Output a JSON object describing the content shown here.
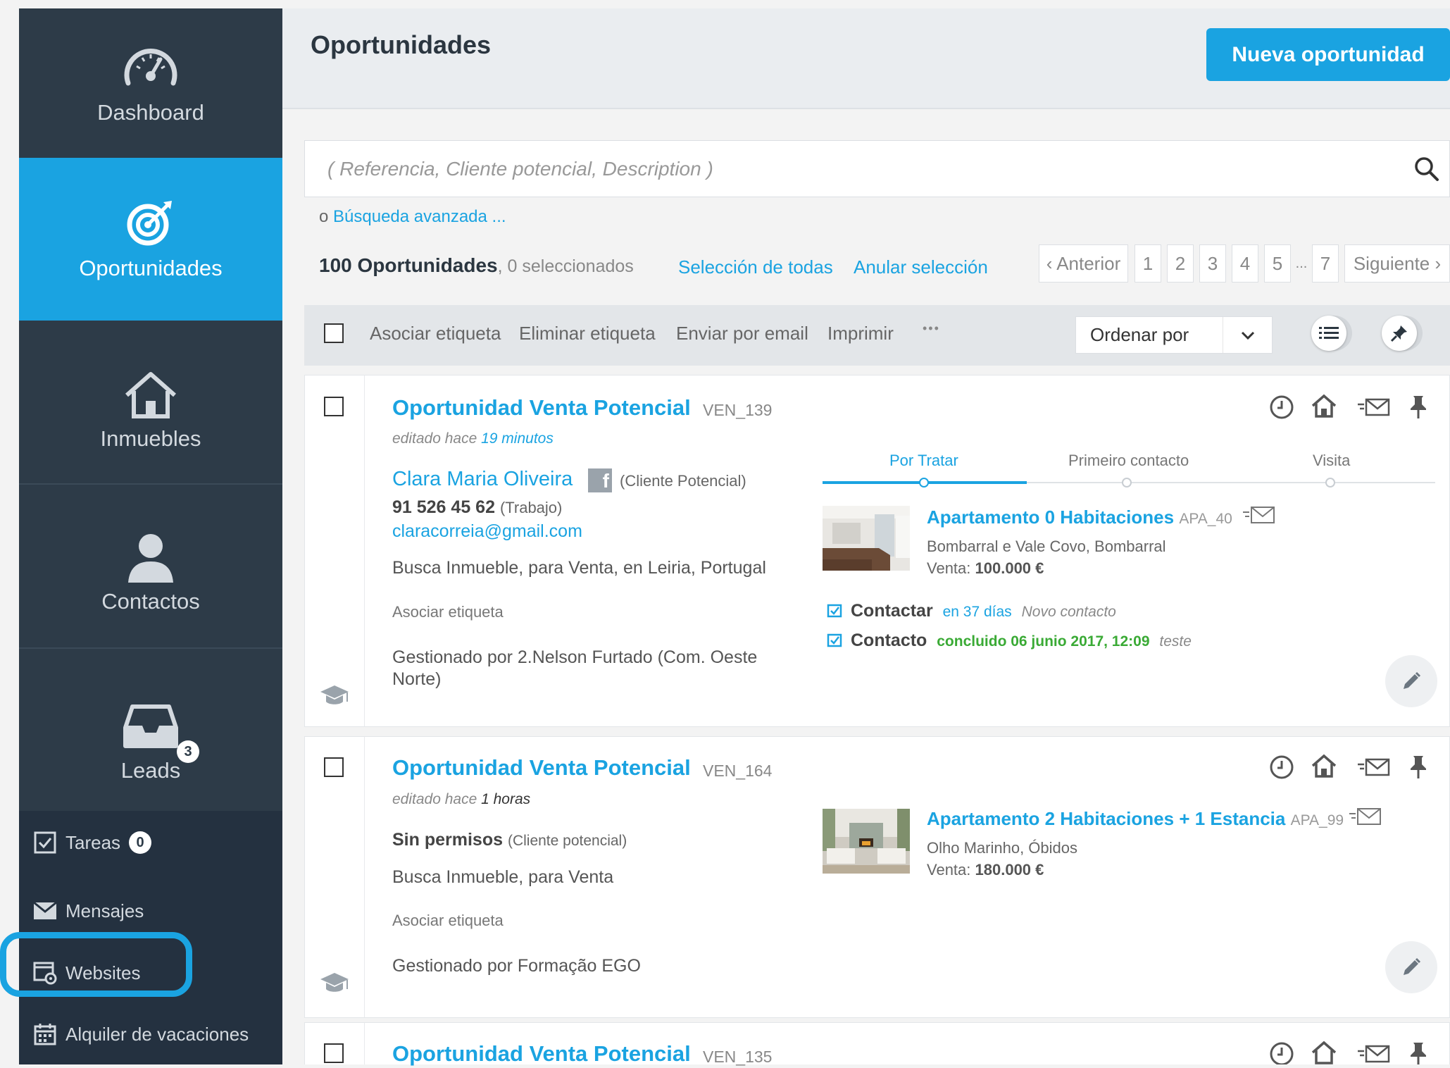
{
  "sidebar": {
    "main": [
      {
        "label": "Dashboard",
        "icon": "speedometer-icon"
      },
      {
        "label": "Oportunidades",
        "icon": "target-icon",
        "active": true
      },
      {
        "label": "Inmuebles",
        "icon": "house-icon"
      },
      {
        "label": "Contactos",
        "icon": "person-icon"
      },
      {
        "label": "Leads",
        "icon": "inbox-icon",
        "badge": "3"
      }
    ],
    "lower": [
      {
        "label": "Tareas",
        "icon": "checkbox-icon",
        "badge": "0"
      },
      {
        "label": "Mensajes",
        "icon": "envelope-icon"
      },
      {
        "label": "Websites",
        "icon": "website-gear-icon",
        "highlighted": true
      },
      {
        "label": "Alquiler de vacaciones",
        "icon": "calendar-icon"
      }
    ]
  },
  "header": {
    "title": "Oportunidades",
    "new_button": "Nueva oportunidad"
  },
  "search": {
    "placeholder": "( Referencia, Cliente potencial, Description )",
    "advanced_prefix": "o",
    "advanced_link": "Búsqueda avanzada ..."
  },
  "summary": {
    "count": "100 Oportunidades",
    "selected": ", 0 seleccionados",
    "select_all": "Selección de todas",
    "clear_selection": "Anular selección"
  },
  "pagination": {
    "prev": "‹ Anterior",
    "pages": [
      "1",
      "2",
      "3",
      "4",
      "5"
    ],
    "ellipsis": "...",
    "last": "7",
    "next": "Siguiente ›"
  },
  "toolbar": {
    "tag": "Asociar etiqueta",
    "untag": "Eliminar etiqueta",
    "email": "Enviar por email",
    "print": "Imprimir",
    "more": "•••",
    "sort_label": "Ordenar por"
  },
  "cards": [
    {
      "title": "Oportunidad Venta Potencial",
      "ref": "VEN_139",
      "edited_prefix": "editado hace ",
      "edited_value": "19 minutos",
      "contact_name": "Clara Maria Oliveira",
      "contact_role": "(Cliente Potencial)",
      "phone": "91 526 45 62",
      "phone_type": "(Trabajo)",
      "email": "claracorreia@gmail.com",
      "search_desc": "Busca Inmueble, para Venta, en Leiria, Portugal",
      "tag_action": "Asociar etiqueta",
      "managed": "Gestionado por 2.Nelson Furtado (Com. Oeste Norte)",
      "stages": [
        "Por Tratar",
        "Primeiro contacto",
        "Visita"
      ],
      "property": {
        "title": "Apartamento 0 Habitaciones",
        "ref": "APA_40",
        "location": "Bombarral e Vale Covo, Bombarral",
        "price_label": "Venta:",
        "price": "100.000 €"
      },
      "tasks": [
        {
          "name": "Contactar",
          "when": "en 37 días",
          "note": "Novo contacto",
          "color": "#1aa3e1"
        },
        {
          "name": "Contacto",
          "when": "concluido 06 junio 2017, 12:09",
          "note": "teste",
          "color": "#3aaa35"
        }
      ]
    },
    {
      "title": "Oportunidad Venta Potencial",
      "ref": "VEN_164",
      "edited_prefix": "editado hace ",
      "edited_value": "1 horas",
      "contact_name": "Sin permisos",
      "contact_role": "(Cliente potencial)",
      "search_desc": "Busca Inmueble, para Venta",
      "tag_action": "Asociar etiqueta",
      "managed": "Gestionado por Formação EGO",
      "property": {
        "title": "Apartamento 2 Habitaciones + 1 Estancia",
        "ref": "APA_99",
        "location": "Olho Marinho, Óbidos",
        "price_label": "Venta:",
        "price": "180.000 €"
      }
    },
    {
      "title": "Oportunidad Venta Potencial",
      "ref": "VEN_135"
    }
  ]
}
